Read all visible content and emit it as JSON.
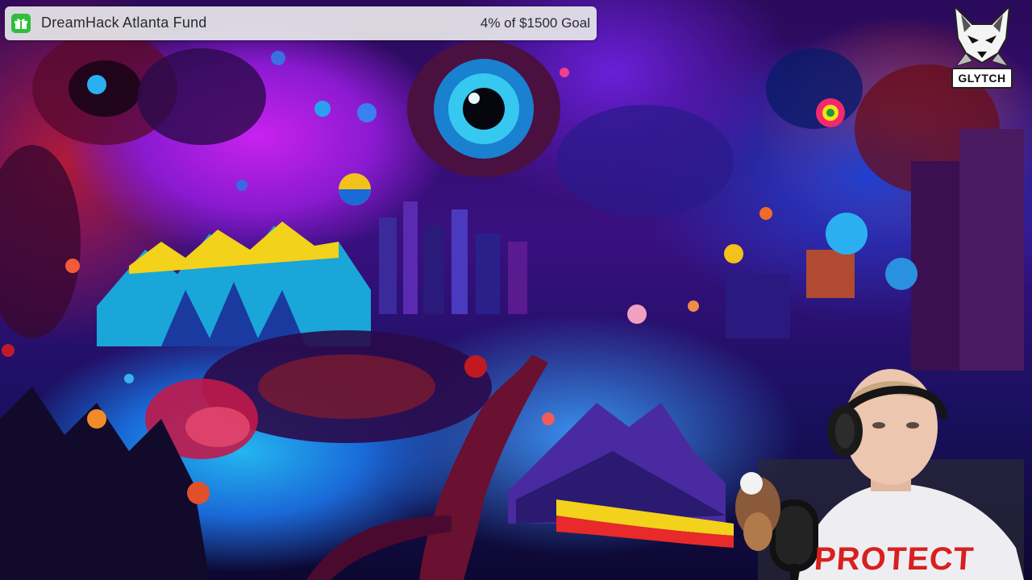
{
  "goal": {
    "icon": "gift-icon",
    "title": "DreamHack Atlanta Fund",
    "progress_text": "4% of $1500 Goal",
    "progress_fraction": 0.04,
    "accent_color": "#2fbf3a"
  },
  "logo": {
    "icon": "fox-mascot-icon",
    "text": "GLYTCH"
  },
  "webcam": {
    "shirt_text": "PROTECT"
  }
}
